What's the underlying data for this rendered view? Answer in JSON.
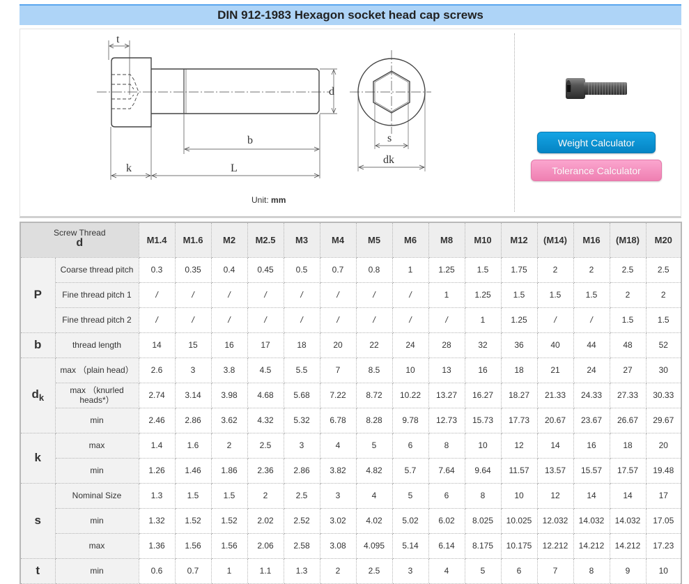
{
  "page": {
    "title": "DIN 912-1983 Hexagon socket head cap screws"
  },
  "figure": {
    "dimension_labels": {
      "t": "t",
      "d": "d",
      "b": "b",
      "k": "k",
      "L": "L",
      "s": "s",
      "dk": "dk"
    },
    "unit_prefix": "Unit:",
    "unit_value": "mm"
  },
  "side_panel": {
    "photo_icon": "hex-socket-screw-photo",
    "weight_calculator_label": "Weight Calculator",
    "tolerance_calculator_label": "Tolerance Calculator",
    "weight_button_color": "#0b94d4",
    "tolerance_button_color": "#f591c0"
  },
  "table": {
    "corner_label": "Screw Thread",
    "corner_symbol": "d",
    "sizes": [
      "M1.4",
      "M1.6",
      "M2",
      "M2.5",
      "M3",
      "M4",
      "M5",
      "M6",
      "M8",
      "M10",
      "M12",
      "(M14)",
      "M16",
      "(M18)",
      "M20"
    ],
    "groups": [
      {
        "symbol": "P",
        "sub": "",
        "rows": [
          {
            "label": "Coarse thread pitch",
            "values": [
              "0.3",
              "0.35",
              "0.4",
              "0.45",
              "0.5",
              "0.7",
              "0.8",
              "1",
              "1.25",
              "1.5",
              "1.75",
              "2",
              "2",
              "2.5",
              "2.5"
            ]
          },
          {
            "label": "Fine thread pitch 1",
            "values": [
              "/",
              "/",
              "/",
              "/",
              "/",
              "/",
              "/",
              "/",
              "1",
              "1.25",
              "1.5",
              "1.5",
              "1.5",
              "2",
              "2"
            ]
          },
          {
            "label": "Fine thread pitch 2",
            "values": [
              "/",
              "/",
              "/",
              "/",
              "/",
              "/",
              "/",
              "/",
              "/",
              "1",
              "1.25",
              "/",
              "/",
              "1.5",
              "1.5"
            ]
          }
        ]
      },
      {
        "symbol": "b",
        "sub": "",
        "rows": [
          {
            "label": "thread length",
            "values": [
              "14",
              "15",
              "16",
              "17",
              "18",
              "20",
              "22",
              "24",
              "28",
              "32",
              "36",
              "40",
              "44",
              "48",
              "52"
            ]
          }
        ]
      },
      {
        "symbol": "d",
        "sub": "k",
        "rows": [
          {
            "label": "max （plain head）",
            "values": [
              "2.6",
              "3",
              "3.8",
              "4.5",
              "5.5",
              "7",
              "8.5",
              "10",
              "13",
              "16",
              "18",
              "21",
              "24",
              "27",
              "30"
            ]
          },
          {
            "label": "max （knurled heads*）",
            "values": [
              "2.74",
              "3.14",
              "3.98",
              "4.68",
              "5.68",
              "7.22",
              "8.72",
              "10.22",
              "13.27",
              "16.27",
              "18.27",
              "21.33",
              "24.33",
              "27.33",
              "30.33"
            ]
          },
          {
            "label": "min",
            "values": [
              "2.46",
              "2.86",
              "3.62",
              "4.32",
              "5.32",
              "6.78",
              "8.28",
              "9.78",
              "12.73",
              "15.73",
              "17.73",
              "20.67",
              "23.67",
              "26.67",
              "29.67"
            ]
          }
        ]
      },
      {
        "symbol": "k",
        "sub": "",
        "rows": [
          {
            "label": "max",
            "values": [
              "1.4",
              "1.6",
              "2",
              "2.5",
              "3",
              "4",
              "5",
              "6",
              "8",
              "10",
              "12",
              "14",
              "16",
              "18",
              "20"
            ]
          },
          {
            "label": "min",
            "values": [
              "1.26",
              "1.46",
              "1.86",
              "2.36",
              "2.86",
              "3.82",
              "4.82",
              "5.7",
              "7.64",
              "9.64",
              "11.57",
              "13.57",
              "15.57",
              "17.57",
              "19.48"
            ]
          }
        ]
      },
      {
        "symbol": "s",
        "sub": "",
        "rows": [
          {
            "label": "Nominal Size",
            "values": [
              "1.3",
              "1.5",
              "1.5",
              "2",
              "2.5",
              "3",
              "4",
              "5",
              "6",
              "8",
              "10",
              "12",
              "14",
              "14",
              "17"
            ]
          },
          {
            "label": "min",
            "values": [
              "1.32",
              "1.52",
              "1.52",
              "2.02",
              "2.52",
              "3.02",
              "4.02",
              "5.02",
              "6.02",
              "8.025",
              "10.025",
              "12.032",
              "14.032",
              "14.032",
              "17.05"
            ]
          },
          {
            "label": "max",
            "values": [
              "1.36",
              "1.56",
              "1.56",
              "2.06",
              "2.58",
              "3.08",
              "4.095",
              "5.14",
              "6.14",
              "8.175",
              "10.175",
              "12.212",
              "14.212",
              "14.212",
              "17.23"
            ]
          }
        ]
      },
      {
        "symbol": "t",
        "sub": "",
        "rows": [
          {
            "label": "min",
            "values": [
              "0.6",
              "0.7",
              "1",
              "1.1",
              "1.3",
              "2",
              "2.5",
              "3",
              "4",
              "5",
              "6",
              "7",
              "8",
              "9",
              "10"
            ]
          }
        ]
      }
    ]
  }
}
